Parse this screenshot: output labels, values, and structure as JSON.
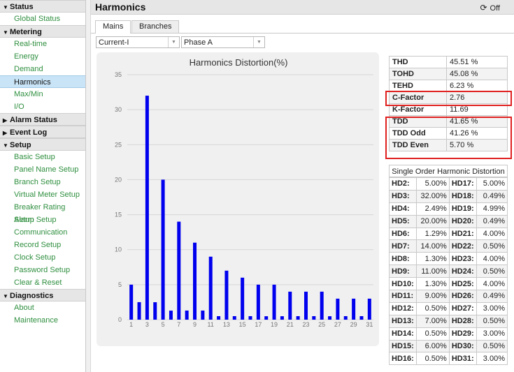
{
  "sidebar": {
    "sections": [
      {
        "label": "Status",
        "expanded": true,
        "items": [
          "Global Status"
        ]
      },
      {
        "label": "Metering",
        "expanded": true,
        "items": [
          "Real-time",
          "Energy",
          "Demand",
          "Harmonics",
          "Max/Min",
          "I/O"
        ]
      },
      {
        "label": "Alarm Status",
        "expanded": false,
        "items": []
      },
      {
        "label": "Event Log",
        "expanded": false,
        "items": []
      },
      {
        "label": "Setup",
        "expanded": true,
        "items": [
          "Basic Setup",
          "Panel Name Setup",
          "Branch Setup",
          "Virtual Meter Setup",
          "Breaker Rating Setup",
          "Alarm Setup",
          "Communication",
          "Record Setup",
          "Clock Setup",
          "Password Setup",
          "Clear & Reset"
        ]
      },
      {
        "label": "Diagnostics",
        "expanded": true,
        "items": [
          "About",
          "Maintenance"
        ]
      }
    ],
    "active_item": "Harmonics"
  },
  "header": {
    "title": "Harmonics",
    "refresh_label": "Off",
    "refresh_icon": "refresh-icon"
  },
  "tabs": [
    {
      "label": "Mains",
      "active": true
    },
    {
      "label": "Branches",
      "active": false
    }
  ],
  "selects": {
    "measurement": "Current-I",
    "phase": "Phase A"
  },
  "chart_data": {
    "type": "bar",
    "title": "Harmonics Distortion(%)",
    "x": [
      1,
      2,
      3,
      4,
      5,
      6,
      7,
      8,
      9,
      10,
      11,
      12,
      13,
      14,
      15,
      16,
      17,
      18,
      19,
      20,
      21,
      22,
      23,
      24,
      25,
      26,
      27,
      28,
      29,
      30,
      31
    ],
    "values": [
      5,
      2.5,
      32,
      2.49,
      20,
      1.29,
      14,
      1.3,
      11,
      1.3,
      9,
      0.5,
      7,
      0.5,
      6,
      0.5,
      5,
      0.49,
      5,
      0.49,
      4,
      0.5,
      4,
      0.5,
      4,
      0.49,
      3,
      0.5,
      3,
      0.5,
      3
    ],
    "x_tick_labels": [
      "1",
      "3",
      "5",
      "7",
      "9",
      "11",
      "13",
      "15",
      "17",
      "19",
      "21",
      "23",
      "25",
      "27",
      "29",
      "31"
    ],
    "ylim": [
      0,
      35
    ],
    "y_ticks": [
      0,
      5,
      10,
      15,
      20,
      25,
      30,
      35
    ],
    "grid": true,
    "bar_color": "#0000ee"
  },
  "summary": {
    "rows": [
      {
        "label": "THD",
        "value": "45.51 %"
      },
      {
        "label": "TOHD",
        "value": "45.08 %"
      },
      {
        "label": "TEHD",
        "value": "6.23 %"
      },
      {
        "label": "C-Factor",
        "value": "2.76"
      },
      {
        "label": "K-Factor",
        "value": "11.69"
      },
      {
        "label": "TDD",
        "value": "41.65 %"
      },
      {
        "label": "TDD Odd",
        "value": "41.26 %"
      },
      {
        "label": "TDD Even",
        "value": "5.70 %"
      }
    ],
    "highlight_color": "#e02020"
  },
  "single_order": {
    "title": "Single Order Harmonic Distortion",
    "rows": [
      [
        "HD2:",
        "5.00%",
        "HD17:",
        "5.00%"
      ],
      [
        "HD3:",
        "32.00%",
        "HD18:",
        "0.49%"
      ],
      [
        "HD4:",
        "2.49%",
        "HD19:",
        "4.99%"
      ],
      [
        "HD5:",
        "20.00%",
        "HD20:",
        "0.49%"
      ],
      [
        "HD6:",
        "1.29%",
        "HD21:",
        "4.00%"
      ],
      [
        "HD7:",
        "14.00%",
        "HD22:",
        "0.50%"
      ],
      [
        "HD8:",
        "1.30%",
        "HD23:",
        "4.00%"
      ],
      [
        "HD9:",
        "11.00%",
        "HD24:",
        "0.50%"
      ],
      [
        "HD10:",
        "1.30%",
        "HD25:",
        "4.00%"
      ],
      [
        "HD11:",
        "9.00%",
        "HD26:",
        "0.49%"
      ],
      [
        "HD12:",
        "0.50%",
        "HD27:",
        "3.00%"
      ],
      [
        "HD13:",
        "7.00%",
        "HD28:",
        "0.50%"
      ],
      [
        "HD14:",
        "0.50%",
        "HD29:",
        "3.00%"
      ],
      [
        "HD15:",
        "6.00%",
        "HD30:",
        "0.50%"
      ],
      [
        "HD16:",
        "0.50%",
        "HD31:",
        "3.00%"
      ]
    ]
  }
}
